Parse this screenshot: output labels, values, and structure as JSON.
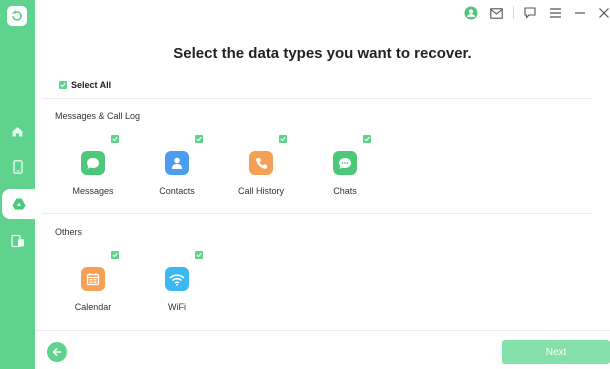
{
  "header": {
    "title": "Select the data types you want to recover."
  },
  "select_all": {
    "label": "Select All",
    "checked": true
  },
  "sections": [
    {
      "label": "Messages & Call Log",
      "items": [
        {
          "label": "Messages",
          "icon": "message-icon",
          "color": "#4cc978",
          "checked": true
        },
        {
          "label": "Contacts",
          "icon": "contact-icon",
          "color": "#4a9df0",
          "checked": true
        },
        {
          "label": "Call History",
          "icon": "phone-icon",
          "color": "#f6a055",
          "checked": true
        },
        {
          "label": "Chats",
          "icon": "chat-icon",
          "color": "#4cc978",
          "checked": true
        }
      ]
    },
    {
      "label": "Others",
      "items": [
        {
          "label": "Calendar",
          "icon": "calendar-icon",
          "color": "#f6a055",
          "checked": true
        },
        {
          "label": "WiFi",
          "icon": "wifi-icon",
          "color": "#3bb8f2",
          "checked": true
        }
      ]
    }
  ],
  "footer": {
    "next_label": "Next"
  },
  "colors": {
    "accent": "#5fd38d",
    "next_button": "#85e0aa"
  }
}
